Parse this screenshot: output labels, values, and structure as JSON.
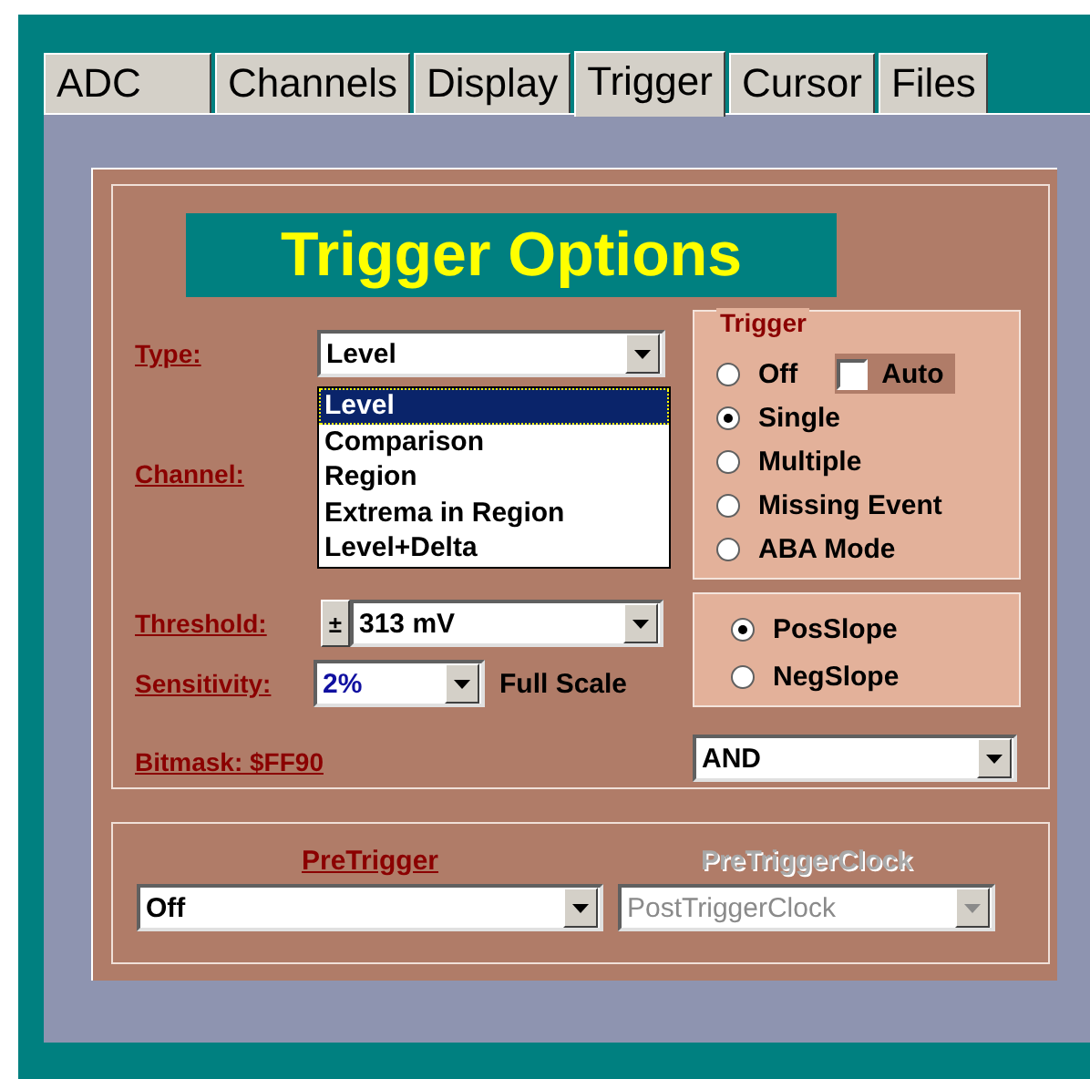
{
  "tabs": [
    {
      "label": "ADC",
      "selected": false
    },
    {
      "label": "Channels",
      "selected": false
    },
    {
      "label": "Display",
      "selected": false
    },
    {
      "label": "Trigger",
      "selected": true
    },
    {
      "label": "Cursor",
      "selected": false
    },
    {
      "label": "Files",
      "selected": false
    }
  ],
  "title": "Trigger Options",
  "type": {
    "label": "Type:",
    "value": "Level",
    "open": true,
    "options": [
      {
        "label": "Level",
        "selected": true
      },
      {
        "label": "Comparison",
        "selected": false
      },
      {
        "label": "Region",
        "selected": false
      },
      {
        "label": "Extrema in Region",
        "selected": false
      },
      {
        "label": "Level+Delta",
        "selected": false
      }
    ]
  },
  "channel": {
    "label": "Channel:"
  },
  "threshold": {
    "label": "Threshold:",
    "sign_button": "±",
    "value": "313 mV"
  },
  "sensitivity": {
    "label": "Sensitivity:",
    "value": "2%",
    "unit": "Full Scale"
  },
  "bitmask": {
    "label": "Bitmask: $FF90"
  },
  "trigger_group": {
    "title": "Trigger",
    "auto": {
      "label": "Auto",
      "checked": false
    },
    "modes": [
      {
        "label": "Off",
        "selected": false
      },
      {
        "label": "Single",
        "selected": true
      },
      {
        "label": "Multiple",
        "selected": false
      },
      {
        "label": "Missing Event",
        "selected": false
      },
      {
        "label": "ABA Mode",
        "selected": false
      }
    ]
  },
  "slope": [
    {
      "label": "PosSlope",
      "selected": true
    },
    {
      "label": "NegSlope",
      "selected": false
    }
  ],
  "logic": {
    "value": "AND"
  },
  "pretrigger": {
    "label": "PreTrigger",
    "value": "Off",
    "disabled": false
  },
  "pretrigger_clock": {
    "label": "PreTriggerClock",
    "value": "PostTriggerClock",
    "disabled": true
  }
}
